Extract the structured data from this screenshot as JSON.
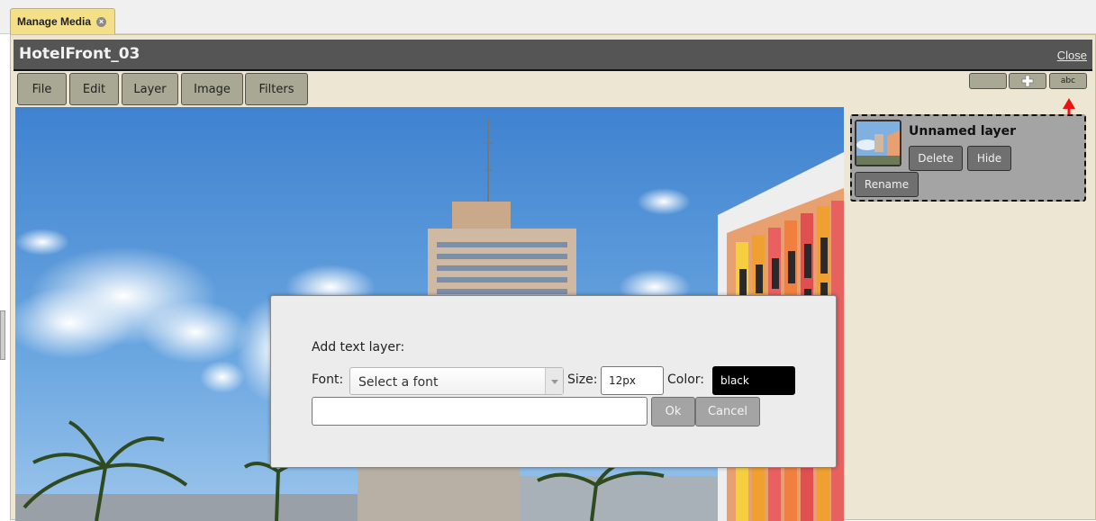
{
  "tab": {
    "label": "Manage Media",
    "close_icon": "×"
  },
  "window": {
    "title": "HotelFront_03",
    "close_label": "Close"
  },
  "menu": [
    {
      "label": "File"
    },
    {
      "label": "Edit"
    },
    {
      "label": "Layer"
    },
    {
      "label": "Image"
    },
    {
      "label": "Filters"
    }
  ],
  "tools": {
    "color_label": "",
    "add_icon": "plus-icon",
    "text_label": "abc"
  },
  "layers": [
    {
      "name": "Unnamed layer",
      "delete_label": "Delete",
      "hide_label": "Hide",
      "rename_label": "Rename"
    }
  ],
  "dialog": {
    "heading": "Add text layer:",
    "font_label": "Font:",
    "font_placeholder": "Select a font",
    "size_label": "Size:",
    "size_value": "12px",
    "color_label": "Color:",
    "color_value": "black",
    "text_value": "",
    "ok_label": "Ok",
    "cancel_label": "Cancel"
  },
  "colors": {
    "tab_background": "#f5e08a",
    "titlebar": "#555555",
    "workspace": "#ede6d2",
    "button": "#a8a894",
    "annotation_arrow": "#ee1111"
  }
}
